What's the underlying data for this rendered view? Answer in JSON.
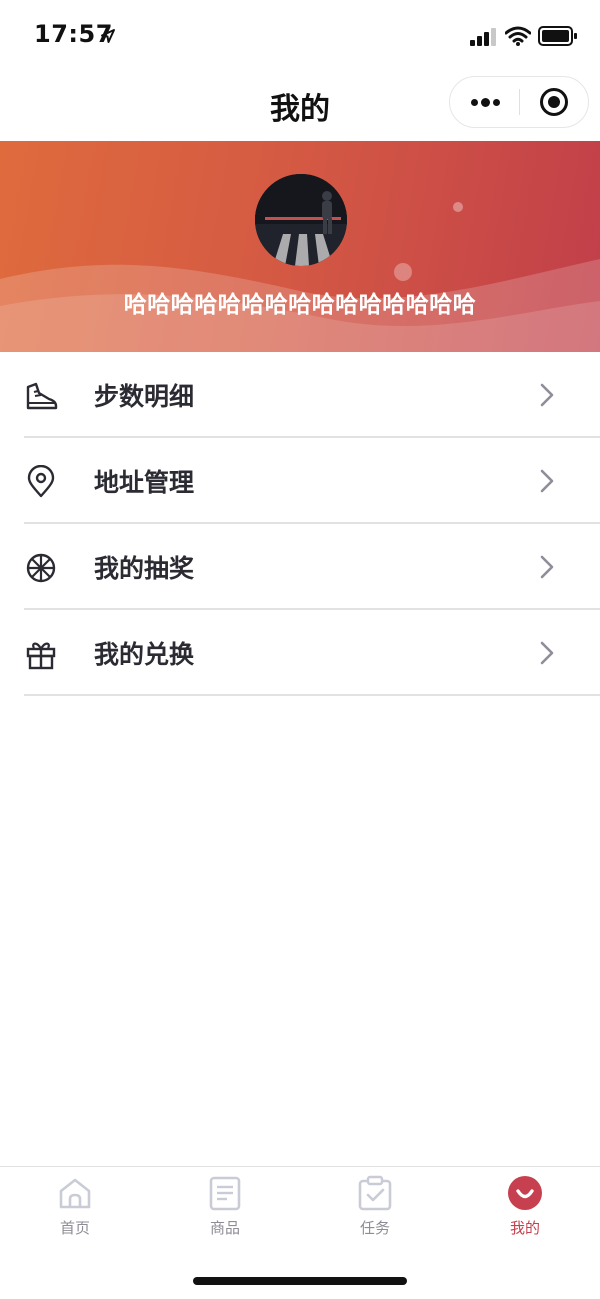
{
  "status_bar": {
    "time": "17:57"
  },
  "nav": {
    "title": "我的"
  },
  "profile": {
    "nickname": "哈哈哈哈哈哈哈哈哈哈哈哈哈哈哈"
  },
  "menu": {
    "items": [
      {
        "label": "步数明细",
        "icon": "shoe-icon"
      },
      {
        "label": "地址管理",
        "icon": "location-pin-icon"
      },
      {
        "label": "我的抽奖",
        "icon": "wheel-icon"
      },
      {
        "label": "我的兑换",
        "icon": "gift-icon"
      }
    ]
  },
  "tabbar": {
    "tabs": [
      {
        "label": "首页",
        "icon": "home-icon",
        "active": false
      },
      {
        "label": "商品",
        "icon": "document-icon",
        "active": false
      },
      {
        "label": "任务",
        "icon": "clipboard-check-icon",
        "active": false
      },
      {
        "label": "我的",
        "icon": "profile-face-icon",
        "active": true
      }
    ]
  },
  "colors": {
    "banner_start": "#df6b3d",
    "banner_end": "#c13f4a",
    "accent": "#c7404f",
    "tab_inactive": "#8d8d96",
    "menu_text": "#2b2b33"
  }
}
